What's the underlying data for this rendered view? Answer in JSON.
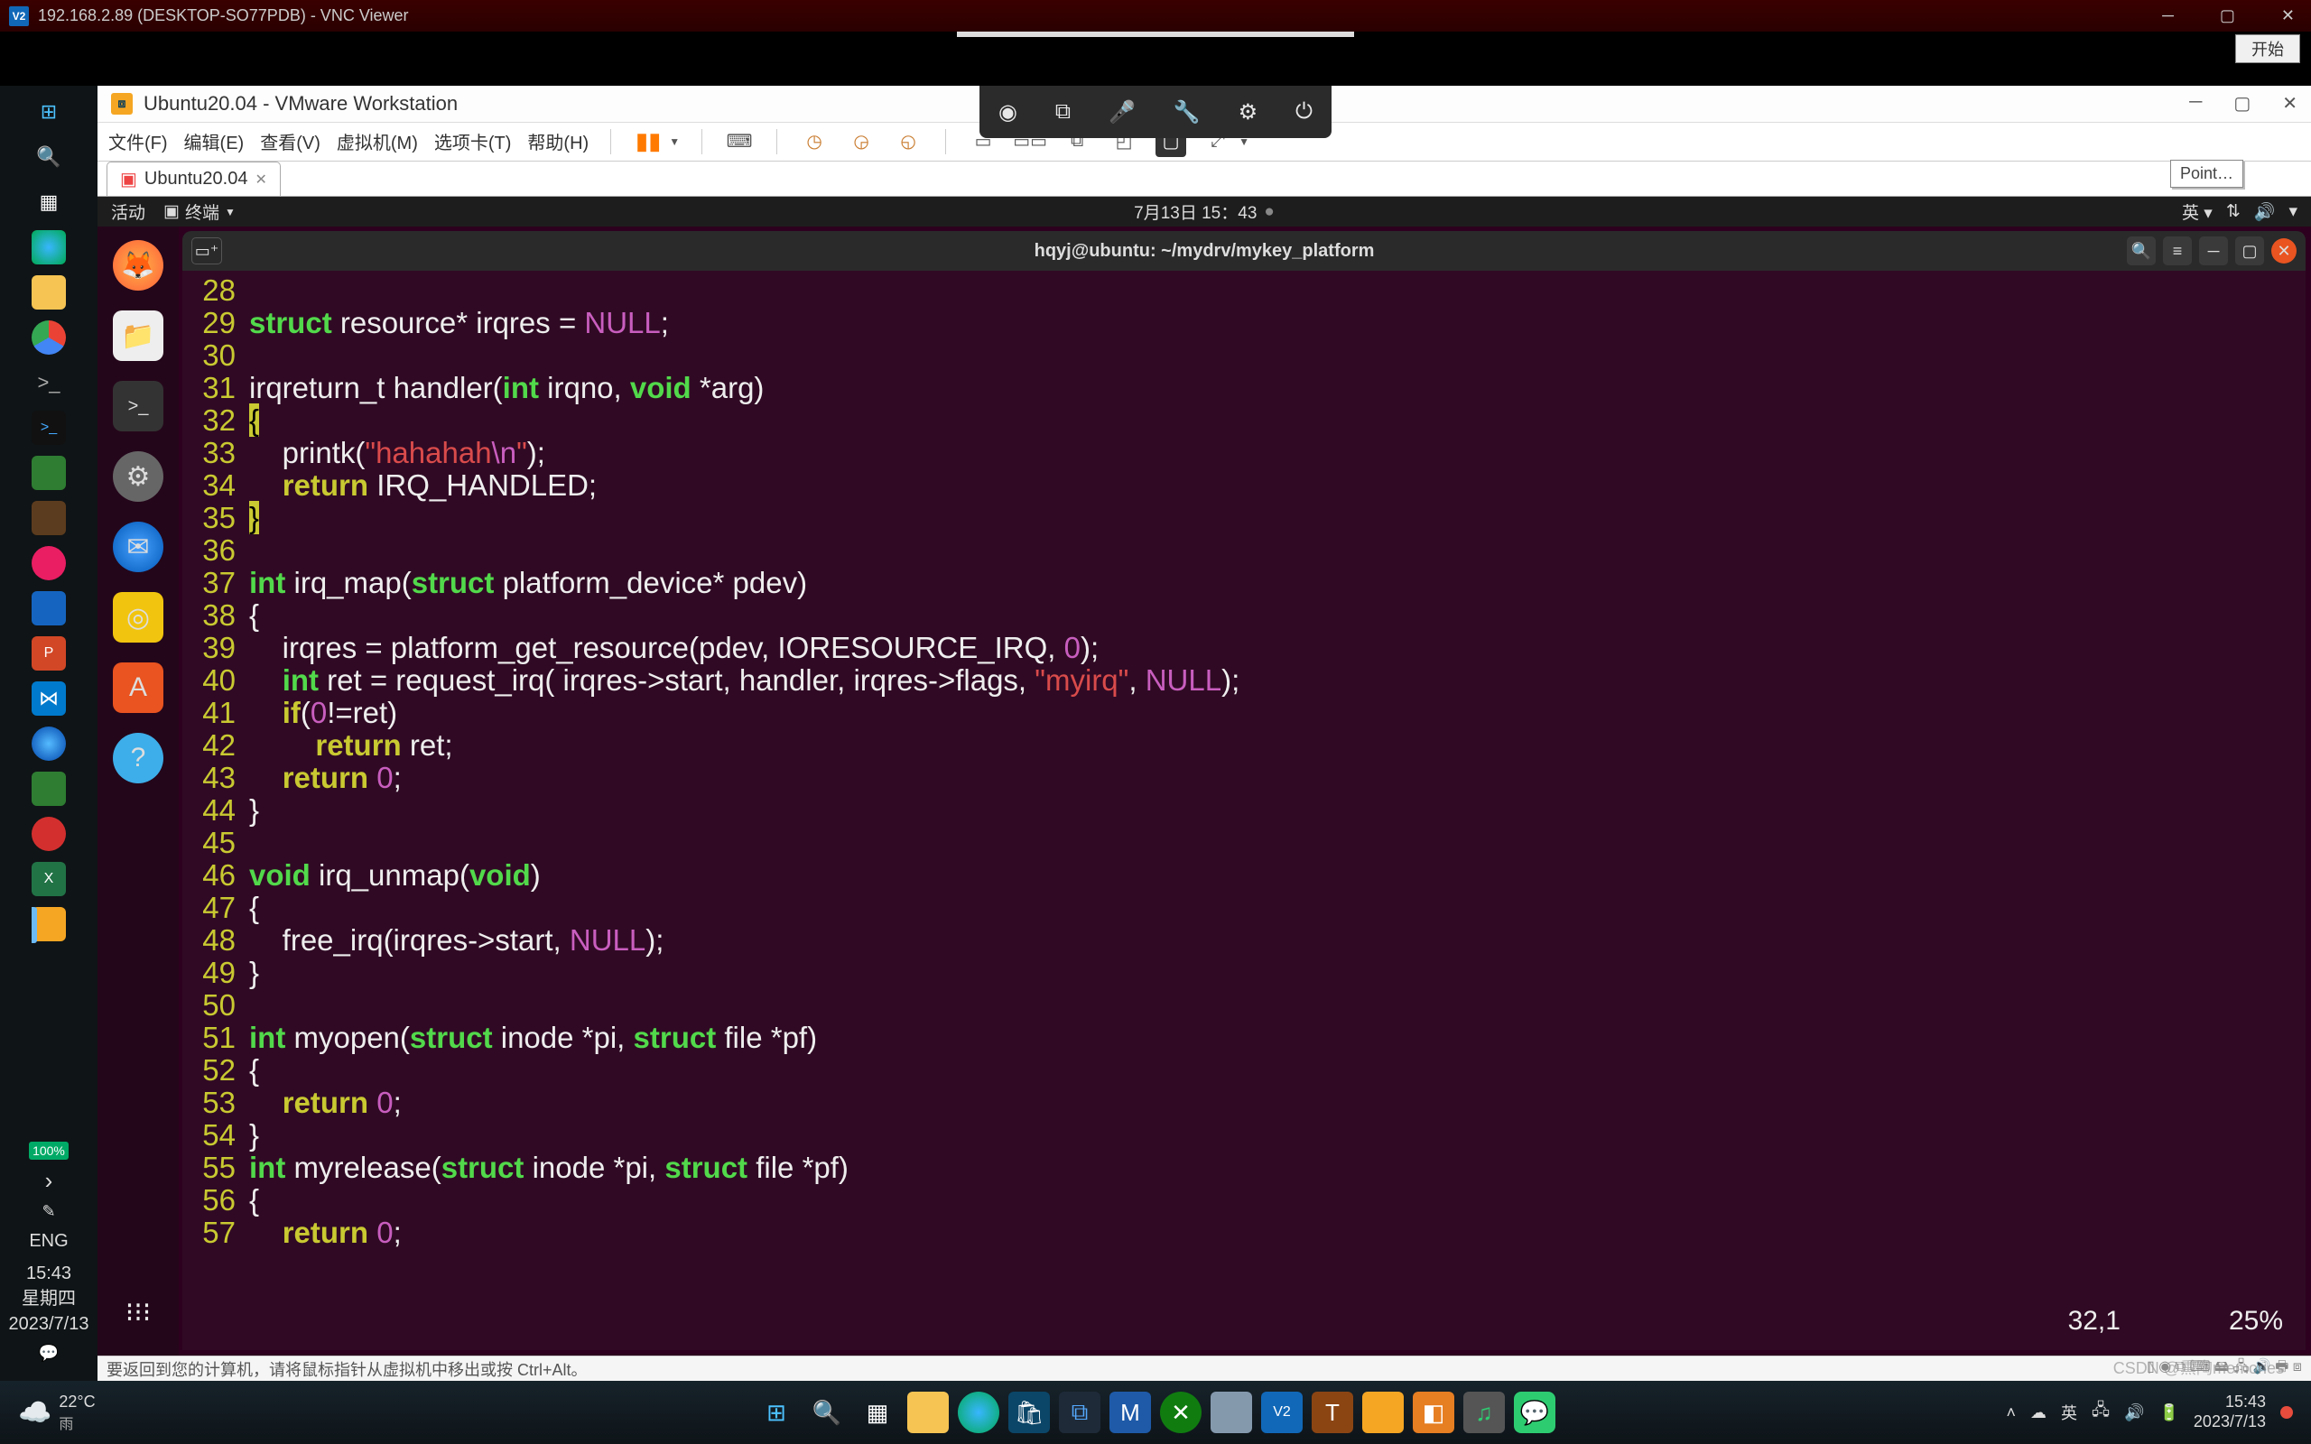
{
  "vnc": {
    "title": "192.168.2.89 (DESKTOP-SO77PDB) - VNC Viewer",
    "logo": "V2"
  },
  "vmware": {
    "title": "Ubuntu20.04 - VMware Workstation",
    "menus": [
      "文件(F)",
      "编辑(E)",
      "查看(V)",
      "虚拟机(M)",
      "选项卡(T)",
      "帮助(H)"
    ],
    "tab": "Ubuntu20.04",
    "point_tooltip": "Point…",
    "start_btn": "开始",
    "status_hint": "要返回到您的计算机，请将鼠标指针从虚拟机中移出或按 Ctrl+Alt。"
  },
  "ubuntu": {
    "activities": "活动",
    "terminal_label": "终端",
    "datetime": "7月13日 15：43",
    "lang": "英",
    "terminal_title": "hqyj@ubuntu: ~/mydrv/mykey_platform"
  },
  "code_lines": [
    {
      "n": 28,
      "segs": []
    },
    {
      "n": 29,
      "segs": [
        {
          "t": "struct",
          "c": "kw-green"
        },
        {
          "t": " resource* irqres = "
        },
        {
          "t": "NULL",
          "c": "kw-magenta"
        },
        {
          "t": ";"
        }
      ]
    },
    {
      "n": 30,
      "segs": []
    },
    {
      "n": 31,
      "segs": [
        {
          "t": "irqreturn_t handler("
        },
        {
          "t": "int",
          "c": "kw-green"
        },
        {
          "t": " irqno, "
        },
        {
          "t": "void",
          "c": "kw-green"
        },
        {
          "t": " *arg)"
        }
      ]
    },
    {
      "n": 32,
      "segs": [
        {
          "t": "{",
          "c": "kw-hl"
        }
      ]
    },
    {
      "n": 33,
      "segs": [
        {
          "t": "    printk("
        },
        {
          "t": "\"hahahah",
          "c": "kw-red"
        },
        {
          "t": "\\n",
          "c": "kw-magenta"
        },
        {
          "t": "\"",
          "c": "kw-red"
        },
        {
          "t": ");"
        }
      ]
    },
    {
      "n": 34,
      "segs": [
        {
          "t": "    "
        },
        {
          "t": "return",
          "c": "kw-yellow"
        },
        {
          "t": " IRQ_HANDLED;"
        }
      ]
    },
    {
      "n": 35,
      "segs": [
        {
          "t": "}",
          "c": "kw-hl"
        }
      ]
    },
    {
      "n": 36,
      "segs": []
    },
    {
      "n": 37,
      "segs": [
        {
          "t": "int",
          "c": "kw-green"
        },
        {
          "t": " irq_map("
        },
        {
          "t": "struct",
          "c": "kw-green"
        },
        {
          "t": " platform_device* pdev)"
        }
      ]
    },
    {
      "n": 38,
      "segs": [
        {
          "t": "{"
        }
      ]
    },
    {
      "n": 39,
      "segs": [
        {
          "t": "    irqres = platform_get_resource(pdev, IORESOURCE_IRQ, "
        },
        {
          "t": "0",
          "c": "kw-magenta"
        },
        {
          "t": ");"
        }
      ]
    },
    {
      "n": 40,
      "segs": [
        {
          "t": "    "
        },
        {
          "t": "int",
          "c": "kw-green"
        },
        {
          "t": " ret = request_irq( irqres->start, handler, irqres->flags, "
        },
        {
          "t": "\"myirq\"",
          "c": "kw-red"
        },
        {
          "t": ", "
        },
        {
          "t": "NULL",
          "c": "kw-magenta"
        },
        {
          "t": ");"
        }
      ]
    },
    {
      "n": 41,
      "segs": [
        {
          "t": "    "
        },
        {
          "t": "if",
          "c": "kw-yellow"
        },
        {
          "t": "("
        },
        {
          "t": "0",
          "c": "kw-magenta"
        },
        {
          "t": "!=ret)"
        }
      ]
    },
    {
      "n": 42,
      "segs": [
        {
          "t": "        "
        },
        {
          "t": "return",
          "c": "kw-yellow"
        },
        {
          "t": " ret;"
        }
      ]
    },
    {
      "n": 43,
      "segs": [
        {
          "t": "    "
        },
        {
          "t": "return",
          "c": "kw-yellow"
        },
        {
          "t": " "
        },
        {
          "t": "0",
          "c": "kw-magenta"
        },
        {
          "t": ";"
        }
      ]
    },
    {
      "n": 44,
      "segs": [
        {
          "t": "}"
        }
      ]
    },
    {
      "n": 45,
      "segs": []
    },
    {
      "n": 46,
      "segs": [
        {
          "t": "void",
          "c": "kw-green"
        },
        {
          "t": " irq_unmap("
        },
        {
          "t": "void",
          "c": "kw-green"
        },
        {
          "t": ")"
        }
      ]
    },
    {
      "n": 47,
      "segs": [
        {
          "t": "{"
        }
      ]
    },
    {
      "n": 48,
      "segs": [
        {
          "t": "    free_irq(irqres->start, "
        },
        {
          "t": "NULL",
          "c": "kw-magenta"
        },
        {
          "t": ");"
        }
      ]
    },
    {
      "n": 49,
      "segs": [
        {
          "t": "}"
        }
      ]
    },
    {
      "n": 50,
      "segs": []
    },
    {
      "n": 51,
      "segs": [
        {
          "t": "int",
          "c": "kw-green"
        },
        {
          "t": " myopen("
        },
        {
          "t": "struct",
          "c": "kw-green"
        },
        {
          "t": " inode *pi, "
        },
        {
          "t": "struct",
          "c": "kw-green"
        },
        {
          "t": " file *pf)"
        }
      ]
    },
    {
      "n": 52,
      "segs": [
        {
          "t": "{"
        }
      ]
    },
    {
      "n": 53,
      "segs": [
        {
          "t": "    "
        },
        {
          "t": "return",
          "c": "kw-yellow"
        },
        {
          "t": " "
        },
        {
          "t": "0",
          "c": "kw-magenta"
        },
        {
          "t": ";"
        }
      ]
    },
    {
      "n": 54,
      "segs": [
        {
          "t": "}"
        }
      ]
    },
    {
      "n": 55,
      "segs": [
        {
          "t": "int",
          "c": "kw-green"
        },
        {
          "t": " myrelease("
        },
        {
          "t": "struct",
          "c": "kw-green"
        },
        {
          "t": " inode *pi, "
        },
        {
          "t": "struct",
          "c": "kw-green"
        },
        {
          "t": " file *pf)"
        }
      ]
    },
    {
      "n": 56,
      "segs": [
        {
          "t": "{"
        }
      ]
    },
    {
      "n": 57,
      "segs": [
        {
          "t": "    "
        },
        {
          "t": "return",
          "c": "kw-yellow"
        },
        {
          "t": " "
        },
        {
          "t": "0",
          "c": "kw-magenta"
        },
        {
          "t": ";"
        }
      ]
    }
  ],
  "vim_status": {
    "pos": "32,1",
    "pct": "25%"
  },
  "win_left": {
    "icons": [
      "start",
      "search",
      "widgets",
      "edge",
      "files",
      "mail",
      "chrome",
      "cmd",
      "term",
      "code",
      "store",
      "mail2",
      "mail3",
      "blue",
      "ppt",
      "vscode",
      "browser",
      "store2",
      "red",
      "excel",
      "vmware"
    ],
    "battery": "100%",
    "expand": "›",
    "pen": "✎",
    "lang": "ENG",
    "clock_time": "15:43",
    "clock_day": "星期四",
    "clock_date": "2023/7/13",
    "chat": "💬"
  },
  "win_bottom": {
    "weather_temp": "22°C",
    "weather_desc": "雨",
    "tray_lang": "英",
    "clock_time": "15:43",
    "clock_date": "2023/7/13"
  },
  "watermark": "CSDN @熏陶memories"
}
